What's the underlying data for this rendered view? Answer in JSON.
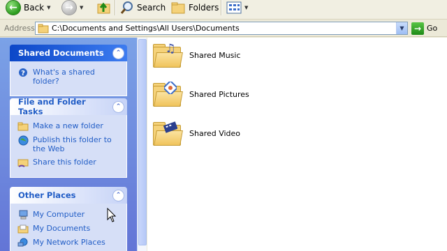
{
  "toolbar": {
    "back_label": "Back",
    "search_label": "Search",
    "folders_label": "Folders"
  },
  "address": {
    "label": "Address",
    "path": "C:\\Documents and Settings\\All Users\\Documents",
    "go_label": "Go"
  },
  "taskpane": {
    "shared": {
      "title": "Shared Documents",
      "links": [
        {
          "label": "What's a shared folder?",
          "icon": "help-icon"
        }
      ]
    },
    "tasks": {
      "title": "File and Folder Tasks",
      "links": [
        {
          "label": "Make a new folder",
          "icon": "new-folder-icon"
        },
        {
          "label": "Publish this folder to the Web",
          "icon": "publish-web-icon"
        },
        {
          "label": "Share this folder",
          "icon": "share-folder-icon"
        }
      ]
    },
    "places": {
      "title": "Other Places",
      "links": [
        {
          "label": "My Computer",
          "icon": "my-computer-icon"
        },
        {
          "label": "My Documents",
          "icon": "my-documents-icon"
        },
        {
          "label": "My Network Places",
          "icon": "network-places-icon"
        }
      ]
    }
  },
  "files": [
    {
      "name": "Shared Music",
      "icon": "music-folder-icon"
    },
    {
      "name": "Shared Pictures",
      "icon": "pictures-folder-icon"
    },
    {
      "name": "Shared Video",
      "icon": "video-folder-icon"
    }
  ],
  "colors": {
    "link": "#215dc6",
    "pane_gradient_top": "#7ba2e7",
    "pane_gradient_bottom": "#6375d6",
    "special_header": "#0c47c8"
  }
}
